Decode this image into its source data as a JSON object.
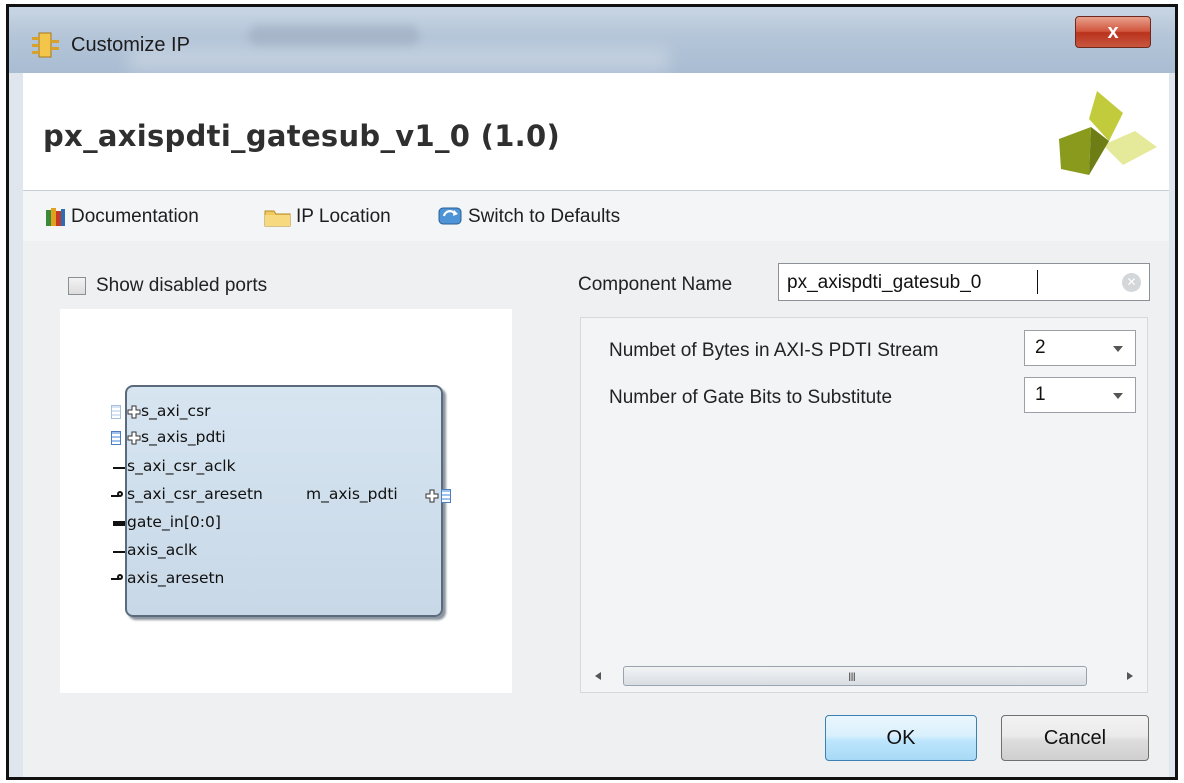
{
  "window": {
    "title": "Customize IP",
    "close_glyph": "x"
  },
  "header": {
    "ip_title": "px_axispdti_gatesub_v1_0 (1.0)"
  },
  "toolbar": {
    "documentation": "Documentation",
    "ip_location": "IP Location",
    "switch_defaults": "Switch to Defaults"
  },
  "left_panel": {
    "show_disabled_label": "Show disabled ports",
    "show_disabled_checked": false,
    "ports_left": [
      "s_axi_csr",
      "s_axis_pdti",
      "s_axi_csr_aclk",
      "s_axi_csr_aresetn",
      "gate_in[0:0]",
      "axis_aclk",
      "axis_aresetn"
    ],
    "ports_right": [
      "m_axis_pdti"
    ]
  },
  "form": {
    "component_name_label": "Component Name",
    "component_name_value": "px_axispdti_gatesub_0",
    "params": [
      {
        "label": "Numbet of Bytes in AXI-S PDTI Stream",
        "value": "2"
      },
      {
        "label": "Number of Gate Bits to Substitute",
        "value": "1"
      }
    ],
    "scroll_grip": "III"
  },
  "buttons": {
    "ok": "OK",
    "cancel": "Cancel"
  },
  "colors": {
    "accent": "#3c7fb1",
    "block_fill": "#c8d8e7",
    "close_red": "#c8452c"
  }
}
